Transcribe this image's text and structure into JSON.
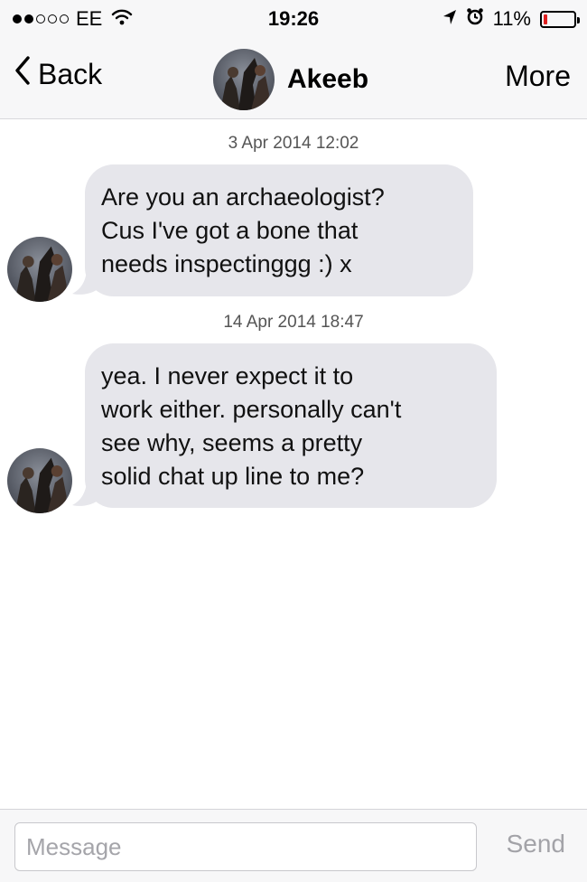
{
  "status_bar": {
    "carrier": "EE",
    "time": "19:26",
    "battery_percent": "11%",
    "battery_level": 0.11,
    "signal_bars_filled": 2,
    "signal_bars_total": 5,
    "icons": [
      "signal-dots-icon",
      "wifi-icon",
      "location-arrow-icon",
      "alarm-clock-icon",
      "battery-icon"
    ]
  },
  "nav": {
    "back_label": "Back",
    "title": "Akeeb",
    "more_label": "More"
  },
  "messages": [
    {
      "timestamp": "3 Apr 2014 12:02",
      "text": "Are you an archaeologist?\nCus I've got a bone that\nneeds inspectinggg :) x"
    },
    {
      "timestamp": "14 Apr 2014 18:47",
      "text": "yea. I never expect it to\nwork either. personally can't\nsee why, seems a pretty\nsolid chat up line to me?"
    }
  ],
  "composer": {
    "placeholder": "Message",
    "value": "",
    "send_label": "Send"
  },
  "colors": {
    "bar_background": "#f7f7f8",
    "bubble_background": "#e6e6eb",
    "battery_low": "#e02020",
    "send_disabled": "#a3a3a8"
  }
}
